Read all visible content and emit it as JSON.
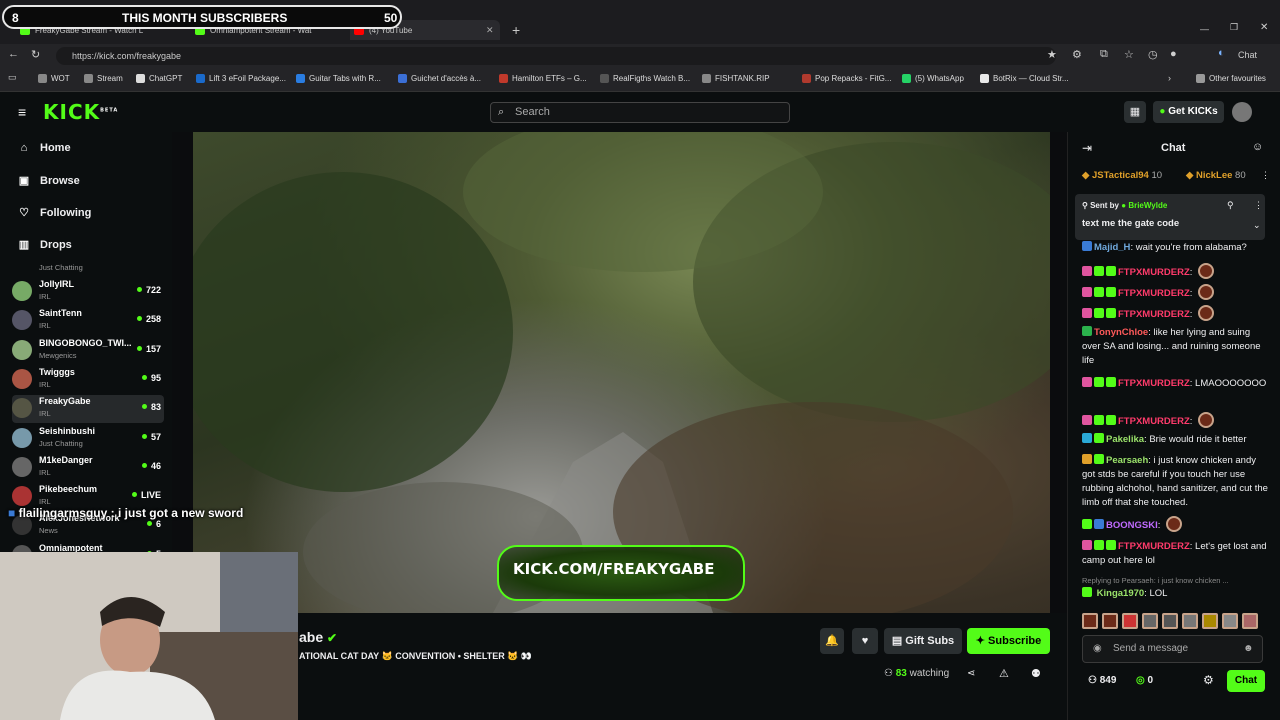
{
  "browser": {
    "tabs": [
      {
        "label": "FreakyGabe Stream - Watch L",
        "color": "#53fc18"
      },
      {
        "label": "Omniampotent Stream - Wat",
        "color": "#53fc18"
      },
      {
        "label": "(4) YouTube",
        "color": "#ff0000"
      }
    ],
    "url": "https://kick.com/freakygabe",
    "copilot_label": "Chat",
    "bookmarks": [
      {
        "label": "WOT",
        "color": "#888"
      },
      {
        "label": "Stream",
        "color": "#888"
      },
      {
        "label": "ChatGPT",
        "color": "#ddd"
      },
      {
        "label": "Lift 3 eFoil Package...",
        "color": "#1a6acb"
      },
      {
        "label": "Guitar Tabs with R...",
        "color": "#2a7de1"
      },
      {
        "label": "Guichet d'accès à...",
        "color": "#3b6fd6"
      },
      {
        "label": "Hamilton ETFs – G...",
        "color": "#c0392b"
      },
      {
        "label": "RealFigths Watch B...",
        "color": "#555"
      },
      {
        "label": "FISHTANK.RIP",
        "color": "#888"
      },
      {
        "label": "Pop Repacks - FitG...",
        "color": "#b03a2e"
      },
      {
        "label": "(5) WhatsApp",
        "color": "#25d366"
      },
      {
        "label": "BotRix — Cloud Str...",
        "color": "#e8e8e8"
      }
    ],
    "other_favourites": "Other favourites"
  },
  "overlay": {
    "banner_left": "8",
    "banner_title": "THIS MONTH SUBSCRIBERS",
    "banner_right": "50",
    "chat_overlay": "flailingarmsguy : i just got a new sword"
  },
  "header": {
    "logo": "KICK",
    "logo_sup": "BETA",
    "search_placeholder": "Search",
    "get_kicks": "Get KICKs"
  },
  "sidebar": {
    "nav": [
      {
        "label": "Home",
        "icon": "home-icon",
        "glyph": "⌂"
      },
      {
        "label": "Browse",
        "icon": "browse-icon",
        "glyph": "▣"
      },
      {
        "label": "Following",
        "icon": "heart-icon",
        "glyph": "♡"
      },
      {
        "label": "Drops",
        "icon": "drops-icon",
        "glyph": "▥"
      }
    ],
    "top_category": "Just Chatting",
    "channels": [
      {
        "name": "JollyIRL",
        "category": "IRL",
        "count": "722",
        "color": "#7a6"
      },
      {
        "name": "SaintTenn",
        "category": "IRL",
        "count": "258",
        "color": "#556"
      },
      {
        "name": "BINGOBONGO_TWI...",
        "category": "Mewgenics",
        "count": "157",
        "color": "#8a7"
      },
      {
        "name": "Twigggs",
        "category": "IRL",
        "count": "95",
        "color": "#a54"
      },
      {
        "name": "FreakyGabe",
        "category": "IRL",
        "count": "83",
        "color": "#554"
      },
      {
        "name": "Seishinbushi",
        "category": "Just Chatting",
        "count": "57",
        "color": "#79a"
      },
      {
        "name": "M1keDanger",
        "category": "IRL",
        "count": "46",
        "color": "#666"
      },
      {
        "name": "Pikebeechum",
        "category": "IRL",
        "count": "LIVE",
        "color": "#a33"
      },
      {
        "name": "AlexJonesNetwork",
        "category": "News",
        "count": "6",
        "color": "#333"
      },
      {
        "name": "Omniampotent",
        "category": "",
        "count": "5",
        "color": "#555"
      }
    ]
  },
  "video": {
    "watermark": "KICK.COM/FREAKYGABE"
  },
  "stream_info": {
    "streamer_name_partial": "abe",
    "title_partial": "ATIONAL CAT DAY 🐱 CONVENTION • SHELTER 🐱 👀",
    "watching_count": "83",
    "watching_label": "watching",
    "gift_subs": "Gift Subs",
    "subscribe": "Subscribe"
  },
  "chat": {
    "title": "Chat",
    "top_gifters": [
      {
        "name": "JSTactical94",
        "count": "10"
      },
      {
        "name": "NickLee",
        "count": "80"
      }
    ],
    "pinned": {
      "sent_by_label": "Sent by",
      "sender": "BrieWylde",
      "text": "text me the gate code"
    },
    "messages": [
      {
        "user": "Majid_H",
        "user_color": "#6fa8dc",
        "text": ": wait you're from alabama?",
        "badges": [
          "#3a7bd5"
        ],
        "emote": false
      },
      {
        "user": "FTPXMURDERZ",
        "user_color": "#ff3b6b",
        "text": ":",
        "badges": [
          "#e0559f",
          "#53fc18",
          "#53fc18"
        ],
        "emote": true
      },
      {
        "user": "FTPXMURDERZ",
        "user_color": "#ff3b6b",
        "text": ":",
        "badges": [
          "#e0559f",
          "#53fc18",
          "#53fc18"
        ],
        "emote": true
      },
      {
        "user": "FTPXMURDERZ",
        "user_color": "#ff3b6b",
        "text": ":",
        "badges": [
          "#e0559f",
          "#53fc18",
          "#53fc18"
        ],
        "emote": true
      },
      {
        "user": "TonynChloe",
        "user_color": "#ff5a5a",
        "text": ": like her lying and suing over SA and losing... and ruining someone life",
        "badges": [
          "#2bb24c"
        ],
        "emote": false
      },
      {
        "user": "FTPXMURDERZ",
        "user_color": "#ff3b6b",
        "text": ": LMAOOOOOOO",
        "badges": [
          "#e0559f",
          "#53fc18",
          "#53fc18"
        ],
        "emote": false
      },
      {
        "user": "FTPXMURDERZ",
        "user_color": "#ff3b6b",
        "text": ":",
        "badges": [
          "#e0559f",
          "#53fc18",
          "#53fc18"
        ],
        "emote": true
      },
      {
        "user": "Pakelika",
        "user_color": "#9be36b",
        "text": ": Brie would ride it better",
        "badges": [
          "#2aa9d6",
          "#53fc18"
        ],
        "emote": false
      },
      {
        "user": "Pearsaeh",
        "user_color": "#9be36b",
        "text": ": i just know chicken andy got stds be careful if you touch her use rubbing alchohol, hand sanitizer, and cut the limb off that she touched.",
        "badges": [
          "#e0a02a",
          "#53fc18"
        ],
        "emote": false
      },
      {
        "user": "BOONGSKI",
        "user_color": "#c06bff",
        "text": ":",
        "badges": [
          "#53fc18",
          "#3a7bd5"
        ],
        "emote": true
      },
      {
        "user": "FTPXMURDERZ",
        "user_color": "#ff3b6b",
        "text": ": Let's get lost and camp out here lol",
        "badges": [
          "#e0559f",
          "#53fc18",
          "#53fc18"
        ],
        "emote": false
      }
    ],
    "reply_to": "Replying to Pearsaeh: i just know chicken ...",
    "last_message": {
      "user": "Kinga1970",
      "user_color": "#9be36b",
      "text": ": LOL"
    },
    "send_placeholder": "Send a message",
    "viewers_count": "849",
    "kicks_count": "0",
    "chat_button": "Chat"
  }
}
